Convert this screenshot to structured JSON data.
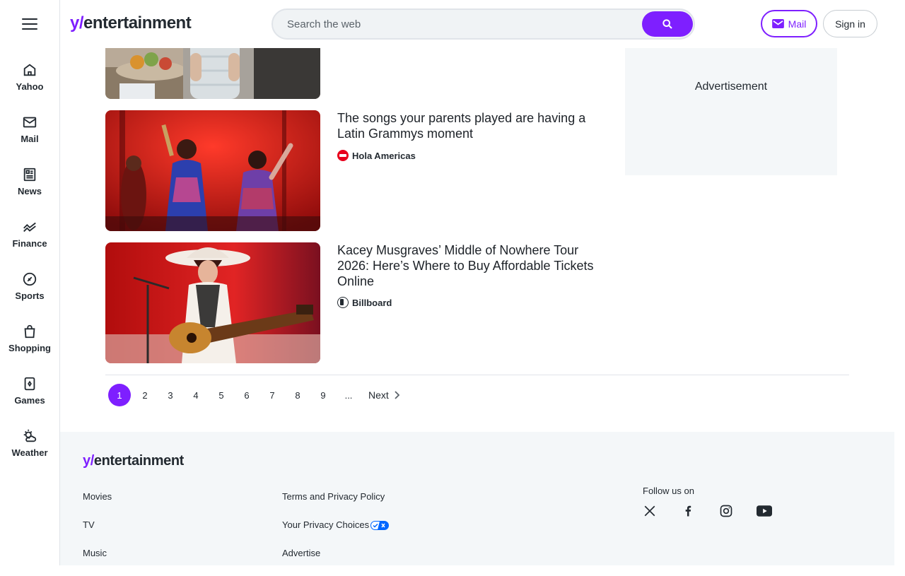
{
  "sidebar": {
    "items": [
      {
        "label": "Yahoo"
      },
      {
        "label": "Mail"
      },
      {
        "label": "News"
      },
      {
        "label": "Finance"
      },
      {
        "label": "Sports"
      },
      {
        "label": "Shopping"
      },
      {
        "label": "Games"
      },
      {
        "label": "Weather"
      }
    ]
  },
  "header": {
    "logo_prefix": "y/",
    "logo_word": "entertainment",
    "search_placeholder": "Search the web",
    "mail_label": "Mail",
    "signin_label": "Sign in"
  },
  "articles": [
    {
      "title": "The songs your parents played are having a Latin Grammys moment",
      "source": "Hola Americas",
      "source_color": "#e8001c"
    },
    {
      "title": "Kacey Musgraves’ Middle of Nowhere Tour 2026: Here’s Where to Buy Affordable Tickets Online",
      "source": "Billboard",
      "source_color": "#232a31"
    }
  ],
  "ad": {
    "label": "Advertisement"
  },
  "pagination": {
    "pages": [
      "1",
      "2",
      "3",
      "4",
      "5",
      "6",
      "7",
      "8",
      "9"
    ],
    "ellipsis": "...",
    "next_label": "Next",
    "active": "1"
  },
  "footer": {
    "logo_prefix": "y/",
    "logo_word": "entertainment",
    "col1": [
      "Movies",
      "TV",
      "Music"
    ],
    "col2": [
      "Terms and Privacy Policy",
      "Your Privacy Choices",
      "Advertise"
    ],
    "follow_label": "Follow us on"
  },
  "colors": {
    "accent": "#7e1fff"
  }
}
